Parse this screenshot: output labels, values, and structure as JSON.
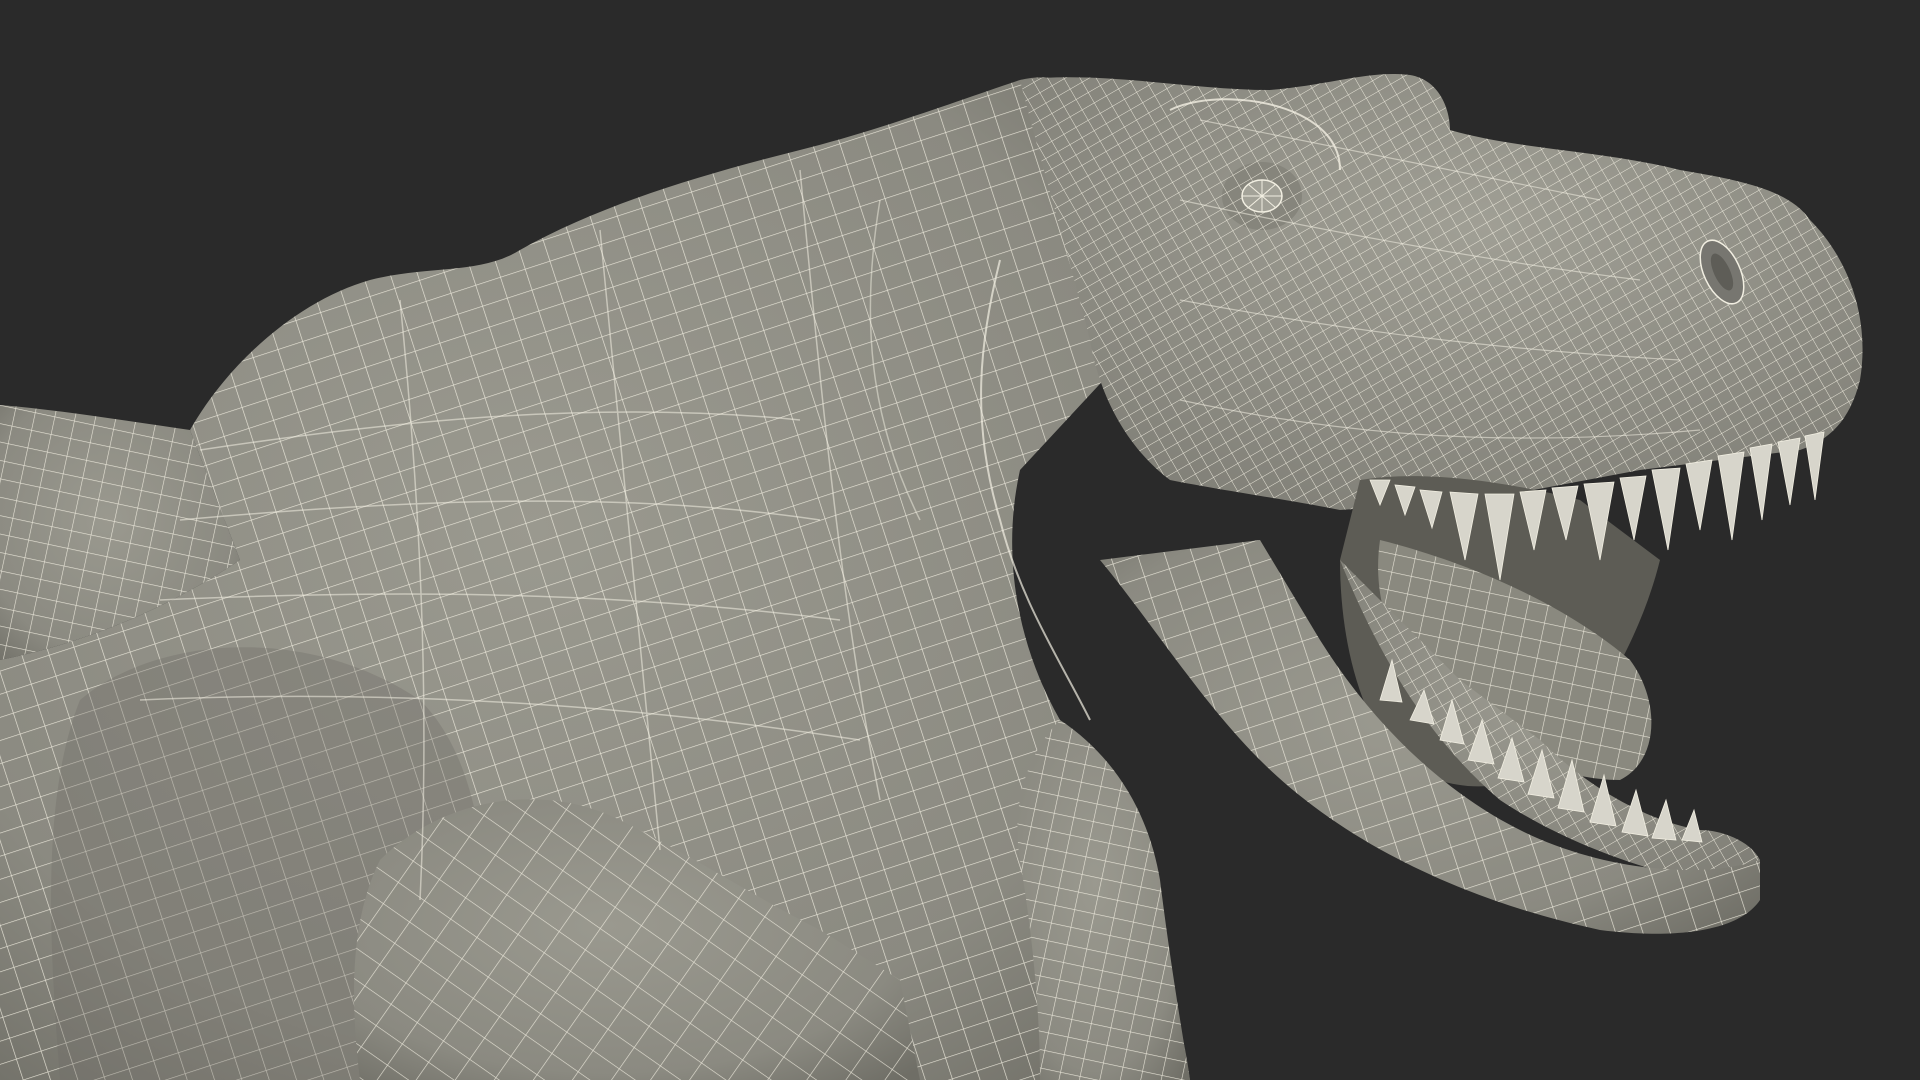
{
  "scene": {
    "background_color": "#2a2a2a",
    "mesh_fill_color": "#8e8d84",
    "mesh_shadow_color": "#6d6c64",
    "wire_color": "#f2efe2",
    "tooth_color": "#d7d5cb",
    "mouth_interior_color": "#5d5c55",
    "subject": "tyrannosaurus-wireframe-model"
  }
}
